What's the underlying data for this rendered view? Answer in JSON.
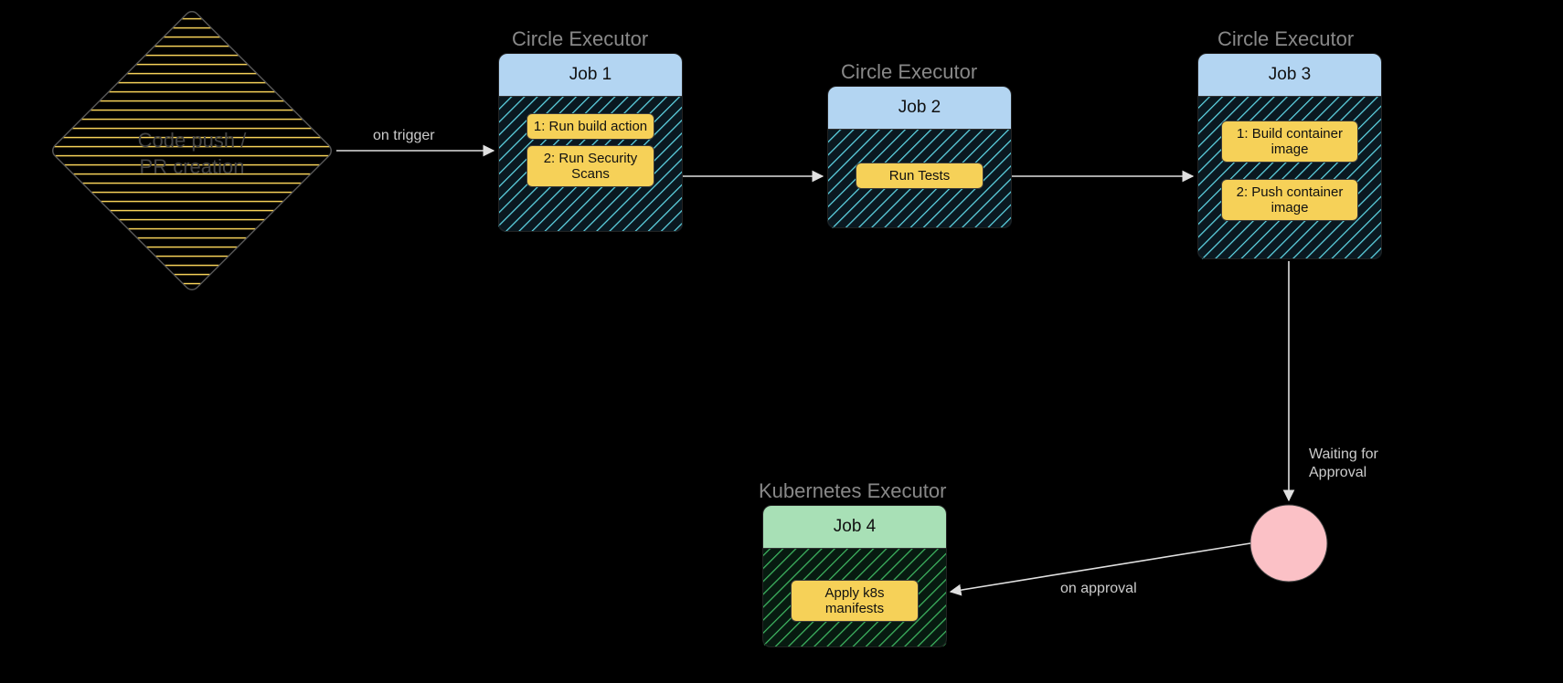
{
  "trigger": {
    "label_line1": "Code push /",
    "label_line2": "PR creation"
  },
  "executors": {
    "job1_title": "Circle Executor",
    "job2_title": "Circle Executor",
    "job3_title": "Circle Executor",
    "job4_title": "Kubernetes Executor"
  },
  "jobs": {
    "job1": {
      "header": "Job 1",
      "steps": [
        "1: Run build action",
        "2: Run Security Scans"
      ]
    },
    "job2": {
      "header": "Job 2",
      "steps": [
        "Run Tests"
      ]
    },
    "job3": {
      "header": "Job 3",
      "steps": [
        "1: Build container image",
        "2: Push container image"
      ]
    },
    "job4": {
      "header": "Job 4",
      "steps": [
        "Apply k8s manifests"
      ]
    }
  },
  "edges": {
    "trigger_to_job1": "on trigger",
    "job3_to_approval_line1": "Waiting for",
    "job3_to_approval_line2": "Approval",
    "approval_to_job4": "on approval"
  },
  "colors": {
    "hatch_yellow": "#f6d158",
    "hatch_cyan": "#5fd7e6",
    "hatch_green": "#3fb862",
    "pink": "#fbc1c6"
  }
}
